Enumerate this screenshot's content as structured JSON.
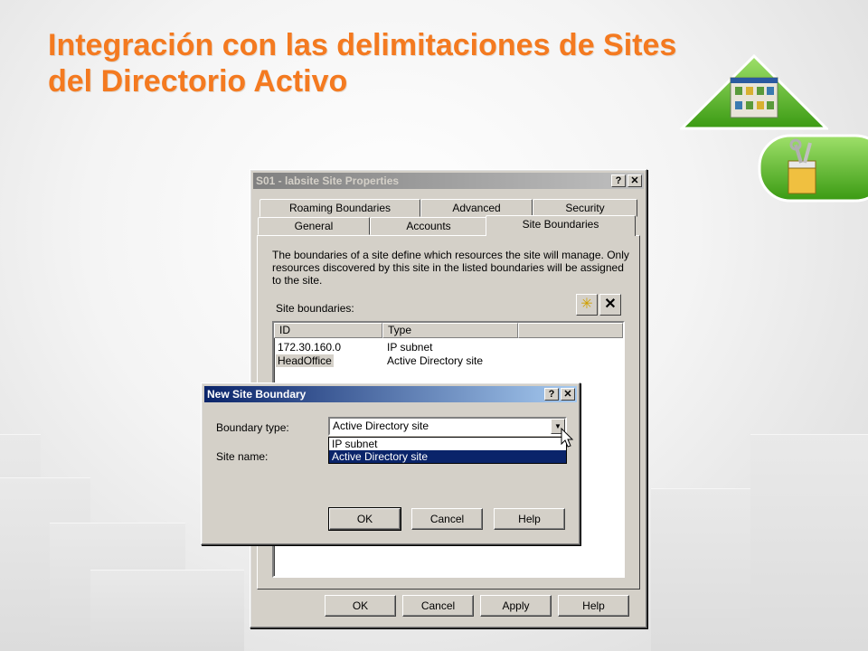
{
  "slide": {
    "title_line1": "Integración con las delimitaciones de Sites",
    "title_line2": "del Directorio Activo"
  },
  "colors": {
    "title": "#f47a20",
    "active_title": "#0a246a",
    "logo_green": "#5cb82a"
  },
  "icons": [
    "triangle-logo-icon",
    "toolbox-icon",
    "new-item-icon",
    "delete-icon",
    "help-icon",
    "close-icon",
    "mouse-cursor-icon",
    "dropdown-arrow-icon"
  ],
  "properties_dialog": {
    "title": "S01 - labsite Site Properties",
    "help_btn": "?",
    "close_btn": "✕",
    "tabs_back": [
      "Roaming Boundaries",
      "Advanced",
      "Security"
    ],
    "tabs_front": [
      "General",
      "Accounts",
      "Site Boundaries"
    ],
    "description": "The boundaries of a site define which resources the site will manage. Only resources discovered by this site in the listed boundaries will be assigned to the site.",
    "site_boundaries_label": "Site boundaries:",
    "columns": [
      "ID",
      "Type"
    ],
    "rows": [
      {
        "id": "172.30.160.0",
        "type": "IP subnet"
      },
      {
        "id": "HeadOffice",
        "type": "Active Directory site"
      }
    ],
    "buttons": {
      "ok": "OK",
      "cancel": "Cancel",
      "apply": "Apply",
      "help": "Help"
    }
  },
  "boundary_dialog": {
    "title": "New Site Boundary",
    "help_btn": "?",
    "close_btn": "✕",
    "boundary_type_label": "Boundary type:",
    "boundary_type_value": "Active Directory site",
    "options": [
      "IP subnet",
      "Active Directory site"
    ],
    "site_name_label": "Site name:",
    "buttons": {
      "ok": "OK",
      "cancel": "Cancel",
      "help": "Help"
    }
  }
}
